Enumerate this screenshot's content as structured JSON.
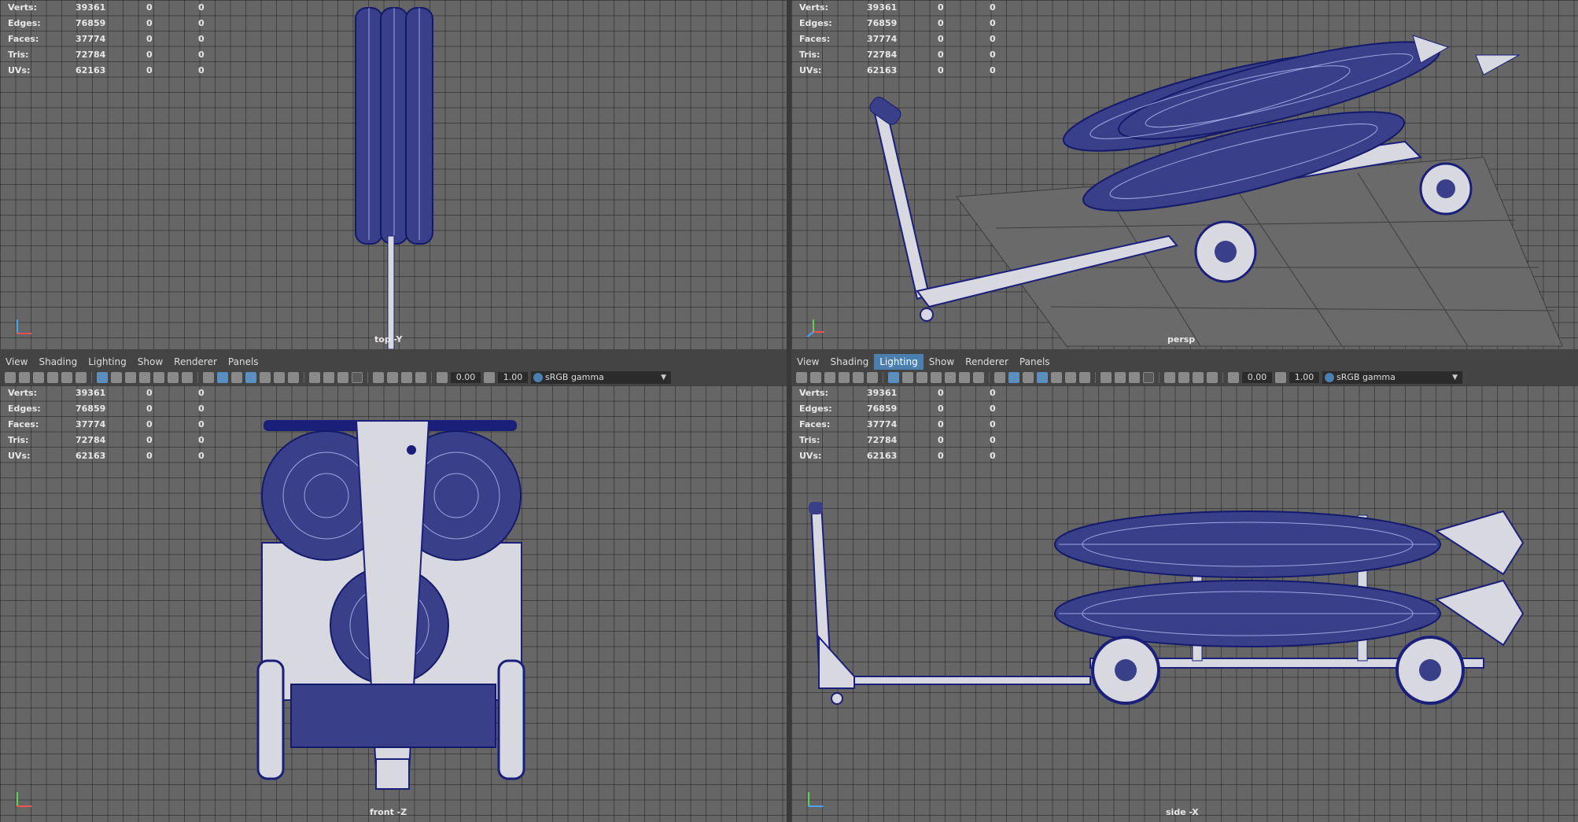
{
  "stats": {
    "rows": [
      {
        "label": "Verts:",
        "v1": "39361",
        "v2": "0",
        "v3": "0"
      },
      {
        "label": "Edges:",
        "v1": "76859",
        "v2": "0",
        "v3": "0"
      },
      {
        "label": "Faces:",
        "v1": "37774",
        "v2": "0",
        "v3": "0"
      },
      {
        "label": "Tris:",
        "v1": "72784",
        "v2": "0",
        "v3": "0"
      },
      {
        "label": "UVs:",
        "v1": "62163",
        "v2": "0",
        "v3": "0"
      }
    ]
  },
  "viewports": {
    "top": {
      "camera": "top -Y"
    },
    "persp": {
      "camera": "persp"
    },
    "front": {
      "camera": "front -Z"
    },
    "side": {
      "camera": "side -X"
    }
  },
  "panel_menu": {
    "items": [
      "View",
      "Shading",
      "Lighting",
      "Show",
      "Renderer",
      "Panels"
    ],
    "active_bottom_right": "Lighting"
  },
  "toolbar": {
    "exposure": "0.00",
    "gamma": "1.00",
    "color_management": "sRGB gamma"
  },
  "colors": {
    "viewport_bg": "#666666",
    "wireframe": "#1a1f7a",
    "model_fill": "#d8d8e0",
    "menu_active": "#4a7fb0"
  }
}
